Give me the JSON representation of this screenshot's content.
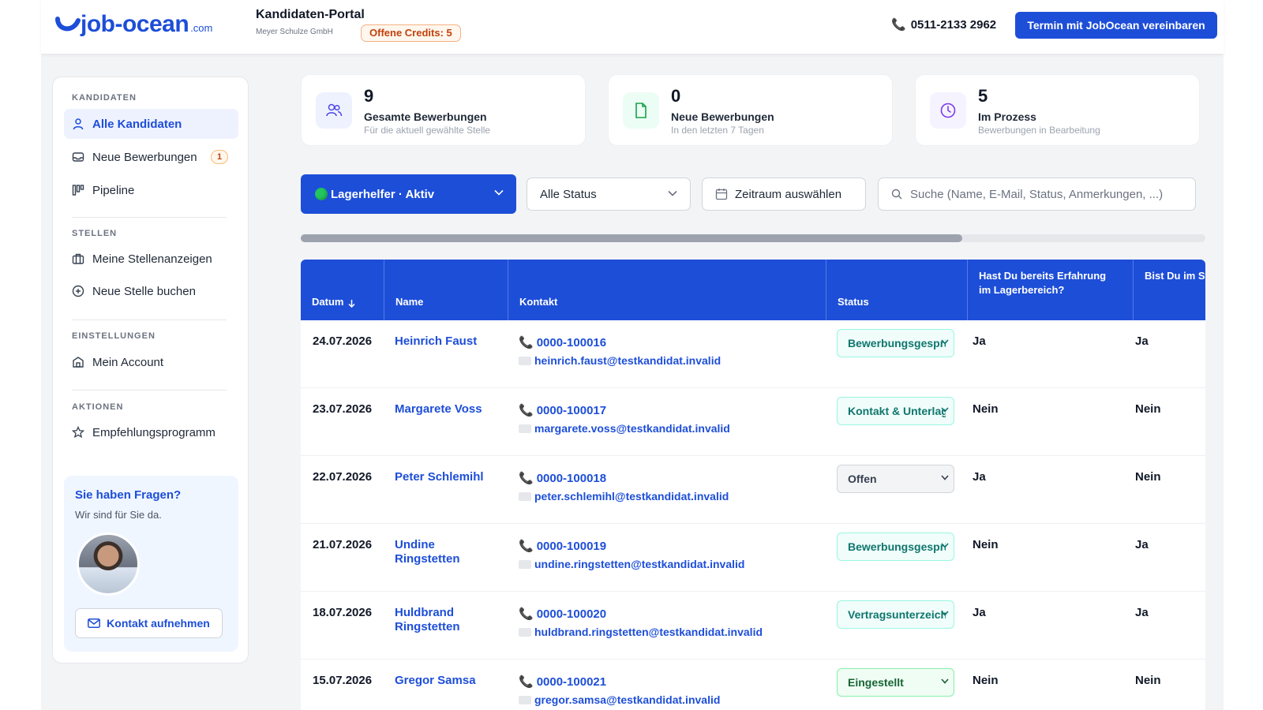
{
  "header": {
    "logo_text": "job-ocean",
    "logo_suffix": ".com",
    "portal_title": "Kandidaten-Portal",
    "company": "Meyer Schulze GmbH",
    "credits": "Offene Credits: 5",
    "phone": "0511-2133 2962",
    "cta": "Termin mit JobOcean vereinbaren"
  },
  "sidebar": {
    "sections": [
      {
        "label": "KANDIDATEN"
      },
      {
        "label": "STELLEN"
      },
      {
        "label": "EINSTELLUNGEN"
      },
      {
        "label": "AKTIONEN"
      }
    ],
    "items": [
      {
        "label": "Alle Kandidaten",
        "icon": "user-icon"
      },
      {
        "label": "Neue Bewerbungen",
        "icon": "inbox-icon",
        "badge": "1"
      },
      {
        "label": "Pipeline",
        "icon": "pipeline-icon"
      },
      {
        "label": "Meine Stellenanzeigen",
        "icon": "briefcase-icon"
      },
      {
        "label": "Neue Stelle buchen",
        "icon": "plus-circle-icon"
      },
      {
        "label": "Mein Account",
        "icon": "building-icon"
      },
      {
        "label": "Empfehlungsprogramm",
        "icon": "star-icon"
      }
    ],
    "help": {
      "title": "Sie haben Fragen?",
      "subtitle": "Wir sind für Sie da.",
      "button": "Kontakt aufnehmen"
    }
  },
  "stats": [
    {
      "value": "9",
      "title": "Gesamte Bewerbungen",
      "subtitle": "Für die aktuell gewählte Stelle",
      "icon": "users-icon",
      "color": "#eef2ff"
    },
    {
      "value": "0",
      "title": "Neue Bewerbungen",
      "subtitle": "In den letzten 7 Tagen",
      "icon": "document-icon",
      "color": "#ecfdf5"
    },
    {
      "value": "5",
      "title": "Im Prozess",
      "subtitle": "Bewerbungen in Bearbeitung",
      "icon": "clock-icon",
      "color": "#f5f3ff"
    }
  ],
  "filters": {
    "job": "Lagerhelfer · Aktiv",
    "status": "Alle Status",
    "date_range": "Zeitraum auswählen",
    "search_placeholder": "Suche (Name, E-Mail, Status, Anmerkungen, ...)"
  },
  "table": {
    "columns": [
      "Datum",
      "Name",
      "Kontakt",
      "Status",
      "Hast Du bereits Erfahrung im Lagerbereich?",
      "Bist Du im Staplersch"
    ],
    "rows": [
      {
        "date": "24.07.2026",
        "name": "Heinrich Faust",
        "phone": "0000-100016",
        "email": "heinrich.faust@testkandidat.invalid",
        "status": "Bewerbungsgespräch",
        "q1": "Ja",
        "q2": "Ja"
      },
      {
        "date": "23.07.2026",
        "name": "Margarete Voss",
        "phone": "0000-100017",
        "email": "margarete.voss@testkandidat.invalid",
        "status": "Kontakt & Unterlagen",
        "q1": "Nein",
        "q2": "Nein"
      },
      {
        "date": "22.07.2026",
        "name": "Peter Schlemihl",
        "phone": "0000-100018",
        "email": "peter.schlemihl@testkandidat.invalid",
        "status": "Offen",
        "q1": "Ja",
        "q2": "Nein"
      },
      {
        "date": "21.07.2026",
        "name": "Undine Ringstetten",
        "phone": "0000-100019",
        "email": "undine.ringstetten@testkandidat.invalid",
        "status": "Bewerbungsgespräch",
        "q1": "Nein",
        "q2": "Ja"
      },
      {
        "date": "18.07.2026",
        "name": "Huldbrand Ringstetten",
        "phone": "0000-100020",
        "email": "huldbrand.ringstetten@testkandidat.invalid",
        "status": "Vertragsunterzeichnung",
        "q1": "Ja",
        "q2": "Ja"
      },
      {
        "date": "15.07.2026",
        "name": "Gregor Samsa",
        "phone": "0000-100021",
        "email": "gregor.samsa@testkandidat.invalid",
        "status": "Eingestellt",
        "q1": "Nein",
        "q2": "Nein"
      }
    ]
  },
  "colors": {
    "brand": "#1d4ed8",
    "accent_orange": "#c2410c"
  }
}
